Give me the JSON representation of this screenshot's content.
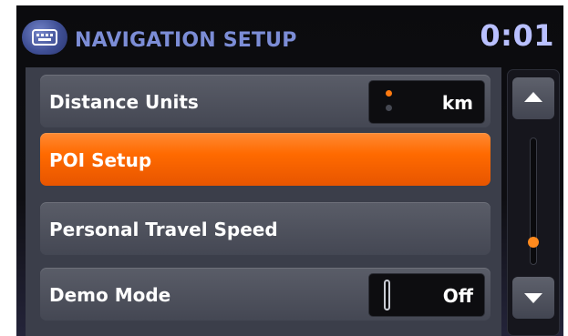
{
  "header": {
    "title": "NAVIGATION SETUP",
    "clock": "0:01",
    "icon": "keyboard-icon"
  },
  "menu": {
    "items": [
      {
        "label": "Distance Units",
        "value": "km",
        "control": "option-dots",
        "active": false
      },
      {
        "label": "POI Setup",
        "active": true
      },
      {
        "label": "Personal Travel Speed",
        "active": false
      },
      {
        "label": "Demo Mode",
        "value": "Off",
        "control": "toggle",
        "active": false
      }
    ]
  },
  "scrollbar": {
    "up_icon": "arrow-up-icon",
    "down_icon": "arrow-down-icon",
    "position": 0.85
  },
  "colors": {
    "accent": "#ff6a00",
    "title": "#7c8dd6",
    "clock": "#b9c0ff"
  }
}
